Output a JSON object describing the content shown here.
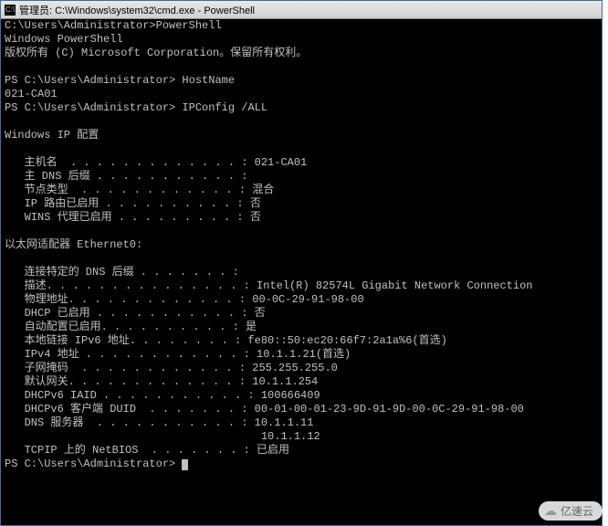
{
  "window": {
    "title": "管理员: C:\\Windows\\system32\\cmd.exe - PowerShell"
  },
  "lines": {
    "cmd_launch": "C:\\Users\\Administrator>PowerShell",
    "banner1": "Windows PowerShell",
    "banner2": "版权所有 (C) Microsoft Corporation。保留所有权利。",
    "prompt1": "PS C:\\Users\\Administrator> HostName",
    "hostname": "021-CA01",
    "prompt2": "PS C:\\Users\\Administrator> IPConfig /ALL",
    "header": "Windows IP 配置",
    "host_cfg_hostname": "   主机名  . . . . . . . . . . . . . : 021-CA01",
    "host_cfg_dnssuffix": "   主 DNS 后缀 . . . . . . . . . . . :",
    "host_cfg_nodetype": "   节点类型  . . . . . . . . . . . . : 混合",
    "host_cfg_iproute": "   IP 路由已启用 . . . . . . . . . . : 否",
    "host_cfg_wins": "   WINS 代理已启用 . . . . . . . . . : 否",
    "adapter_header": "以太网适配器 Ethernet0:",
    "adapter_dnssuffix": "   连接特定的 DNS 后缀 . . . . . . . :",
    "adapter_desc": "   描述. . . . . . . . . . . . . . . : Intel(R) 82574L Gigabit Network Connection",
    "adapter_mac": "   物理地址. . . . . . . . . . . . . : 00-0C-29-91-98-00",
    "adapter_dhcp": "   DHCP 已启用 . . . . . . . . . . . : 否",
    "adapter_autoconf": "   自动配置已启用. . . . . . . . . . : 是",
    "adapter_ipv6": "   本地链接 IPv6 地址. . . . . . . . : fe80::50:ec20:66f7:2a1a%6(首选)",
    "adapter_ipv4": "   IPv4 地址 . . . . . . . . . . . . : 10.1.1.21(首选)",
    "adapter_mask": "   子网掩码  . . . . . . . . . . . . : 255.255.255.0",
    "adapter_gateway": "   默认网关. . . . . . . . . . . . . : 10.1.1.254",
    "adapter_iaid": "   DHCPv6 IAID . . . . . . . . . . . : 100666409",
    "adapter_duid": "   DHCPv6 客户端 DUID  . . . . . . . : 00-01-00-01-23-9D-91-9D-00-0C-29-91-98-00",
    "adapter_dns1": "   DNS 服务器  . . . . . . . . . . . : 10.1.1.11",
    "adapter_dns2": "                                       10.1.1.12",
    "adapter_netbios": "   TCPIP 上的 NetBIOS  . . . . . . . : 已启用",
    "prompt3": "PS C:\\Users\\Administrator> "
  },
  "watermark": {
    "text": "亿速云"
  }
}
